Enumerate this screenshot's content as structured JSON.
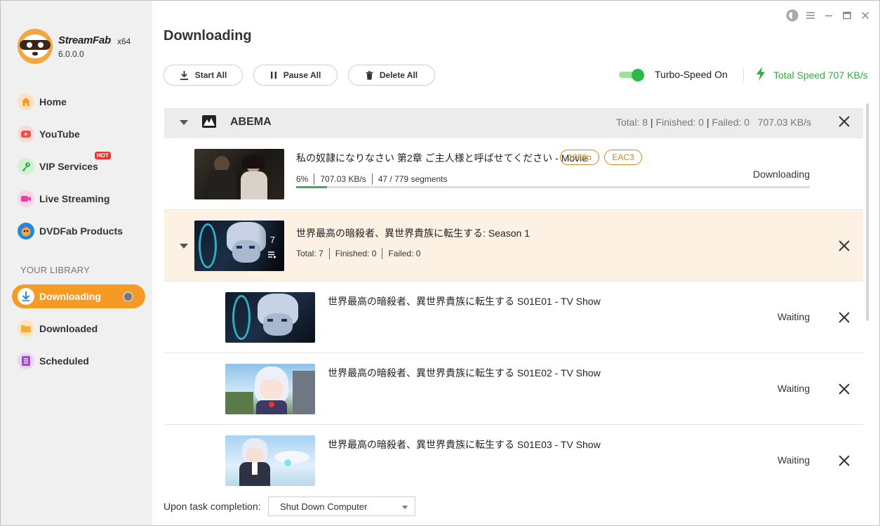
{
  "app": {
    "name": "StreamFab",
    "arch": "x64",
    "version": "6.0.0.0",
    "logo_icon": "sloth-logo-icon"
  },
  "titlebar": {
    "icons": [
      "theme-icon",
      "menu-icon",
      "minimize-icon",
      "maximize-icon",
      "close-icon"
    ]
  },
  "sidebar": {
    "items": [
      {
        "label": "Home",
        "icon": "home-icon",
        "color": "#f49a25"
      },
      {
        "label": "YouTube",
        "icon": "youtube-icon",
        "color": "#e8524a"
      },
      {
        "label": "VIP Services",
        "icon": "key-icon",
        "color": "#3cb44b",
        "badge": "HOT"
      },
      {
        "label": "Live Streaming",
        "icon": "video-camera-icon",
        "color": "#ea3fa2"
      },
      {
        "label": "DVDFab Products",
        "icon": "dvdfab-icon",
        "color": "#1e88e5"
      }
    ],
    "library_title": "YOUR LIBRARY",
    "library": [
      {
        "label": "Downloading",
        "icon": "download-icon",
        "color": "#1e88e5",
        "active": true
      },
      {
        "label": "Downloaded",
        "icon": "folder-icon",
        "color": "#f4b03e"
      },
      {
        "label": "Scheduled",
        "icon": "list-icon",
        "color": "#a14bc7"
      }
    ]
  },
  "main": {
    "title": "Downloading",
    "toolbar": {
      "start_all": "Start All",
      "pause_all": "Pause All",
      "delete_all": "Delete All"
    },
    "turbo": {
      "label": "Turbo-Speed On",
      "enabled": true
    },
    "total_speed": "Total Speed 707 KB/s",
    "accent_green": "#2cae3c"
  },
  "group": {
    "name": "ABEMA",
    "stats": {
      "total_label": "Total: 8",
      "finished_label": "Finished: 0",
      "failed_label": "Failed: 0",
      "speed": "707.03 KB/s"
    },
    "movie": {
      "title": "私の奴隷になりなさい 第2章 ご主人様と呼ばせてください - Movie",
      "tags": [
        "1080p",
        "EAC3"
      ],
      "percent": "6%",
      "progress": 0.06,
      "speed": "707.03 KB/s",
      "segments": "47 / 779 segments",
      "status": "Downloading"
    },
    "season": {
      "title": "世界最高の暗殺者、異世界貴族に転生する: Season 1",
      "episode_count": "7",
      "total": "Total: 7",
      "finished": "Finished: 0",
      "failed": "Failed: 0"
    },
    "episodes": [
      {
        "title": "世界最高の暗殺者、異世界貴族に転生する S01E01 - TV Show",
        "status": "Waiting"
      },
      {
        "title": "世界最高の暗殺者、異世界貴族に転生する S01E02 - TV Show",
        "status": "Waiting"
      },
      {
        "title": "世界最高の暗殺者、異世界貴族に転生する S01E03 - TV Show",
        "status": "Waiting"
      }
    ]
  },
  "footer": {
    "label": "Upon task completion:",
    "selected": "Shut Down Computer"
  }
}
